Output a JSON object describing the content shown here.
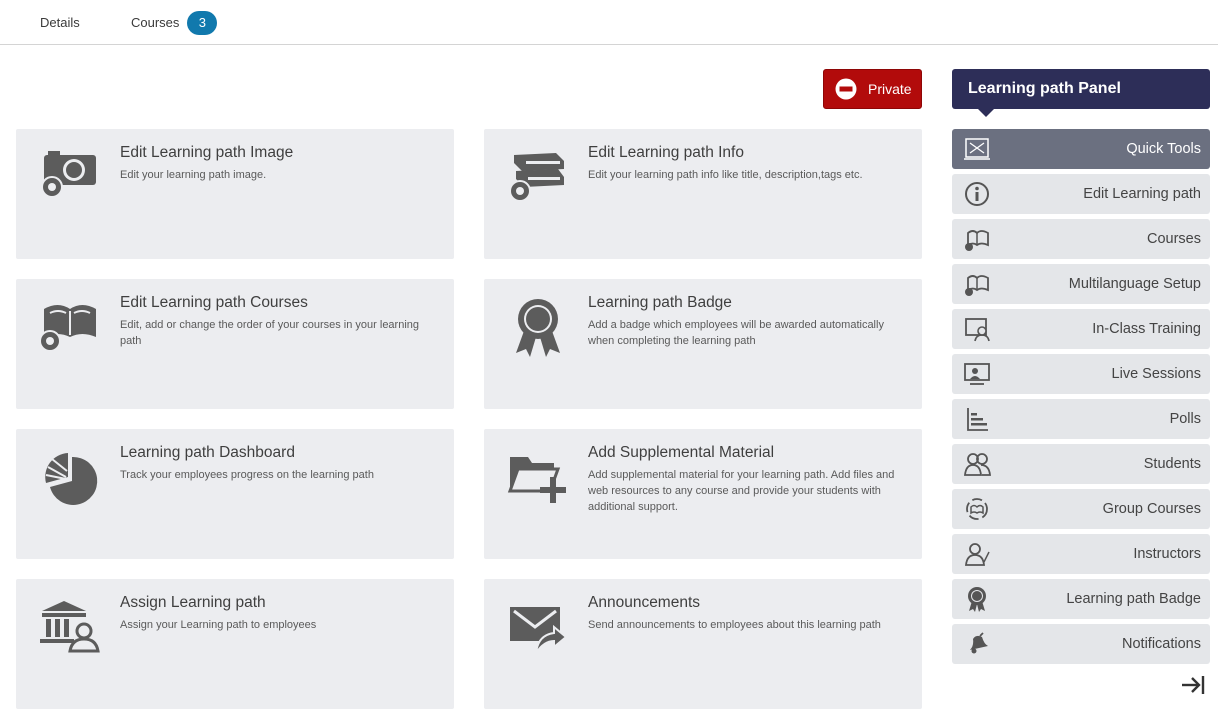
{
  "tabs": {
    "details": "Details",
    "courses": "Courses",
    "courses_count": "3"
  },
  "private_button": {
    "label": "Private",
    "color": "#b20b0b"
  },
  "cards": [
    {
      "title": "Edit Learning path Image",
      "desc": "Edit your learning path image.",
      "icon": "camera-gear-icon"
    },
    {
      "title": "Edit Learning path Info",
      "desc": "Edit your learning path info like title, description,tags etc.",
      "icon": "books-gear-icon"
    },
    {
      "title": "Edit Learning path Courses",
      "desc": "Edit, add or change the order of your courses in your learning path",
      "icon": "open-book-gear-icon"
    },
    {
      "title": "Learning path Badge",
      "desc": "Add a badge which employees will be awarded automatically when completing the learning path",
      "icon": "badge-ribbon-icon"
    },
    {
      "title": "Learning path Dashboard",
      "desc": "Track your employees progress on the learning path",
      "icon": "pie-chart-icon"
    },
    {
      "title": "Add Supplemental Material",
      "desc": "Add supplemental material for your learning path. Add files and web resources to any course and provide your students with additional support.",
      "icon": "folder-add-icon"
    },
    {
      "title": "Assign Learning path",
      "desc": "Assign your Learning path to employees",
      "icon": "institution-user-icon"
    },
    {
      "title": "Announcements",
      "desc": "Send announcements to employees about this learning path",
      "icon": "envelope-share-icon"
    }
  ],
  "panel": {
    "title": "Learning path Panel",
    "title_color": "#2d2e58",
    "items": [
      {
        "label": "Quick Tools",
        "icon": "quick-tools-icon",
        "active": true
      },
      {
        "label": "Edit Learning path",
        "icon": "info-icon"
      },
      {
        "label": "Courses",
        "icon": "courses-icon"
      },
      {
        "label": "Multilanguage Setup",
        "icon": "multilanguage-icon"
      },
      {
        "label": "In-Class Training",
        "icon": "in-class-training-icon"
      },
      {
        "label": "Live Sessions",
        "icon": "live-sessions-icon"
      },
      {
        "label": "Polls",
        "icon": "polls-icon"
      },
      {
        "label": "Students",
        "icon": "students-icon"
      },
      {
        "label": "Group Courses",
        "icon": "group-courses-icon"
      },
      {
        "label": "Instructors",
        "icon": "instructors-icon"
      },
      {
        "label": "Learning path Badge",
        "icon": "badge-icon"
      },
      {
        "label": "Notifications",
        "icon": "bell-icon"
      }
    ]
  }
}
